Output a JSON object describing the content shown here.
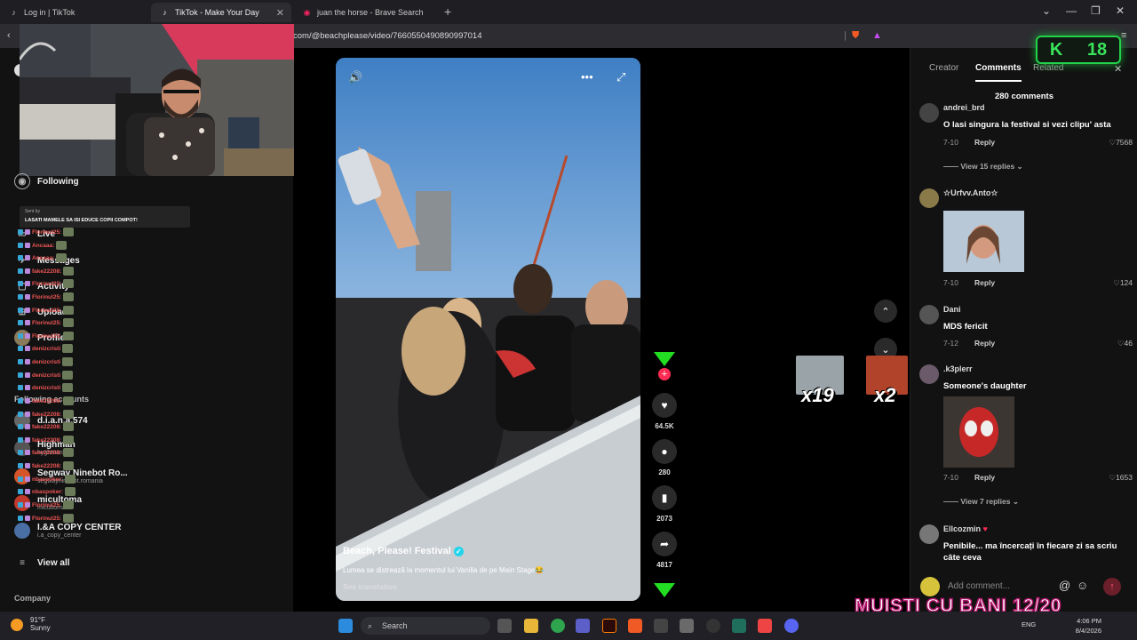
{
  "browser": {
    "tabs": [
      {
        "label": "Log in | TikTok"
      },
      {
        "label": "TikTok - Make Your Day"
      },
      {
        "label": "juan the horse - Brave Search"
      }
    ],
    "url": "com/@beachplease/video/7660550490890997014"
  },
  "sidebar": {
    "items": [
      {
        "label": "Following"
      },
      {
        "label": "Live"
      },
      {
        "label": "Messages"
      },
      {
        "label": "Activity"
      },
      {
        "label": "Upload"
      },
      {
        "label": "Profile"
      }
    ],
    "following_header": "Following accounts",
    "accounts": [
      {
        "name": "d.i.a.n.a.574",
        "handle": ""
      },
      {
        "name": "Highman",
        "handle": "hyghman"
      },
      {
        "name": "Segway Ninebot Ro...",
        "handle": "segwayninebot.romania"
      },
      {
        "name": "micultoma",
        "handle": "micultoma"
      },
      {
        "name": "I.&A COPY CENTER",
        "handle": "i.a_copy_center"
      }
    ],
    "view_all": "View all",
    "company": "Company"
  },
  "chat": {
    "pinned": "LASATI MAMELE SA ISI EDUCE COPII COMPOT!",
    "pinned_meta": "Sent by",
    "messages": [
      {
        "user": "Florinul25:"
      },
      {
        "user": "Ancaaa:"
      },
      {
        "user": "Ancaaa:"
      },
      {
        "user": "fake22208:"
      },
      {
        "user": "Florinul25:"
      },
      {
        "user": "Florinul25:"
      },
      {
        "user": "Florinul25:"
      },
      {
        "user": "Florinul25:"
      },
      {
        "user": "Florinul25:"
      },
      {
        "user": "denizcristi"
      },
      {
        "user": "denizcristi"
      },
      {
        "user": "denizcristi"
      },
      {
        "user": "denizcristi"
      },
      {
        "user": "fake22208:"
      },
      {
        "user": "fake22208:"
      },
      {
        "user": "fake22208:"
      },
      {
        "user": "fake22208:"
      },
      {
        "user": "fake22208:"
      },
      {
        "user": "fake22208:"
      },
      {
        "user": "nbaspoker:"
      },
      {
        "user": "nbaspoker:"
      },
      {
        "user": "Florinul25:"
      },
      {
        "user": "Florinul25:"
      }
    ]
  },
  "video": {
    "account": "Beach, Please! Festival",
    "description": "Lumea se distrează la momentul lui Vanilla de pe Main Stage😂",
    "translate": "See translation"
  },
  "actions": {
    "likes": "64.5K",
    "comments": "280",
    "saves": "2073",
    "shares": "4817"
  },
  "overlays": {
    "emote1_count": "x19",
    "emote2_count": "x2",
    "k_badge_number": "18",
    "banner": "MUISTI CU BANI 12/20"
  },
  "panel": {
    "tabs": [
      "Creator",
      "Comments",
      "Related"
    ],
    "count": "280 comments",
    "comments": [
      {
        "user": "andrei_brd",
        "text": "O lasi singura la festival si vezi clipu' asta",
        "date": "7-10",
        "likes": "7568",
        "replies": "View 15 replies"
      },
      {
        "user": "☆Urfvv.Anto☆",
        "text": "",
        "date": "7-10",
        "likes": "124"
      },
      {
        "user": "Dani",
        "text": "MDS fericit",
        "date": "7-12",
        "likes": "46"
      },
      {
        "user": ".k3plerr",
        "text": "Someone's daughter",
        "date": "7-10",
        "likes": "1653",
        "replies": "View 7 replies"
      },
      {
        "user": "Ellcozmin",
        "text": "Penibile... ma încercați în fiecare zi sa scriu câte ceva",
        "date": "",
        "likes": ""
      }
    ],
    "reply_label": "Reply",
    "add_placeholder": "Add comment..."
  },
  "taskbar": {
    "temp": "91°F",
    "weather": "Sunny",
    "search": "Search",
    "lang": "ENG",
    "time": "4:06 PM",
    "date": "8/4/2026"
  }
}
